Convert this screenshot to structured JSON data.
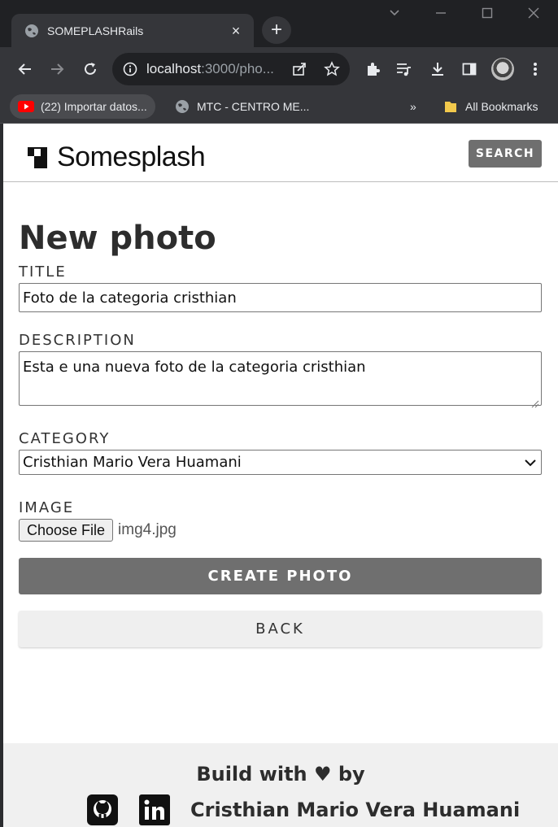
{
  "browser": {
    "tab_title": "SOMEPLASHRails",
    "tab_close": "×",
    "new_tab": "+",
    "url_host": "localhost",
    "url_rest": ":3000/pho...",
    "bookmarks": [
      {
        "label": "(22) Importar datos..."
      },
      {
        "label": "MTC - CENTRO ME..."
      }
    ],
    "bookmarks_more": "»",
    "all_bookmarks": "All Bookmarks"
  },
  "header": {
    "logo_text": "Somesplash",
    "search_label": "SEARCH"
  },
  "form": {
    "title": "New photo",
    "title_label": "TITLE",
    "title_value": "Foto de la categoria cristhian",
    "description_label": "DESCRIPTION",
    "description_value": "Esta e una nueva foto de la categoria cristhian",
    "category_label": "CATEGORY",
    "category_value": "Cristhian Mario Vera Huamani",
    "image_label": "IMAGE",
    "choose_file_label": "Choose File",
    "file_name": "img4.jpg",
    "create_label": "CREATE PHOTO",
    "back_label": "BACK"
  },
  "footer": {
    "line1": "Build with ♥ by",
    "author": "Cristhian Mario Vera Huamani",
    "icons": [
      "github-icon",
      "linkedin-icon"
    ]
  },
  "colors": {
    "button_gray": "#6f6f6f",
    "footer_bg": "#f0f0f0",
    "browser_dark": "#202124"
  }
}
